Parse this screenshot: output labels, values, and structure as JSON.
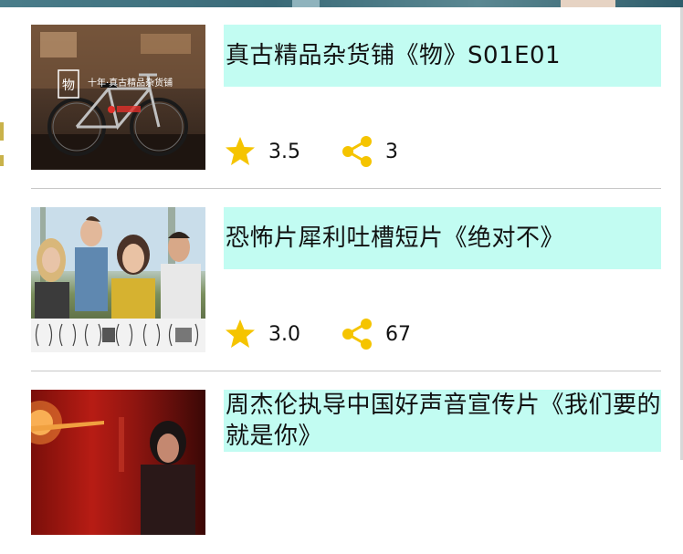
{
  "colors": {
    "title_bg": "#c2fcf2",
    "star": "#f5c400",
    "share": "#f5c400",
    "divider": "#c8c8c8"
  },
  "items": [
    {
      "title": "真古精品杂货铺《物》S01E01",
      "rating": "3.5",
      "shares": "3",
      "thumb_icon": "bicycle-shop-thumbnail",
      "thumb_caption": "十年·真古精品杂货铺"
    },
    {
      "title": "恐怖片犀利吐槽短片《绝对不》",
      "rating": "3.0",
      "shares": "67",
      "thumb_icon": "four-people-forest-thumbnail"
    },
    {
      "title": "周杰伦执导中国好声音宣传片《我们要的就是你》",
      "rating": "",
      "shares": "",
      "thumb_icon": "red-fire-scene-thumbnail"
    }
  ]
}
